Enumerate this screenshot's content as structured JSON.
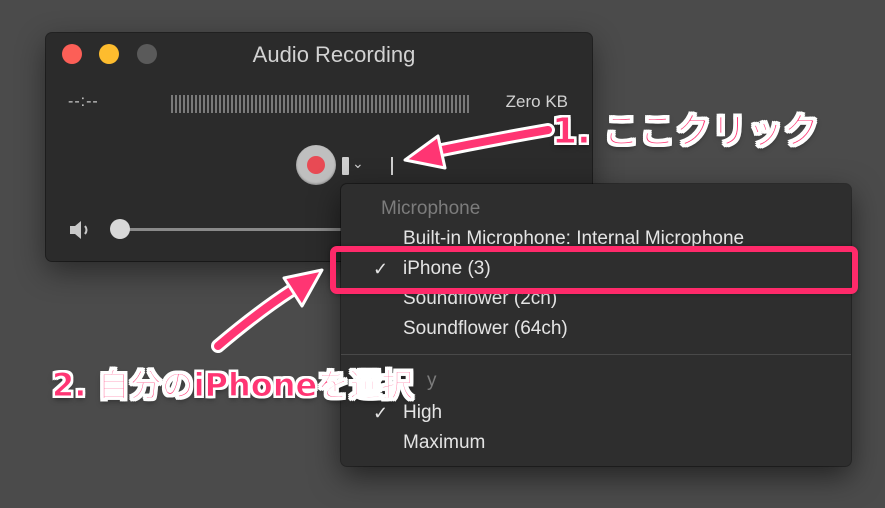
{
  "window": {
    "title": "Audio Recording",
    "elapsed_time": "--:--",
    "file_size": "Zero KB"
  },
  "menu": {
    "microphone_header": "Microphone",
    "microphones": [
      {
        "label": "Built-in Microphone: Internal Microphone",
        "checked": false
      },
      {
        "label": "iPhone (3)",
        "checked": true
      },
      {
        "label": "Soundflower (2ch)",
        "checked": false
      },
      {
        "label": "Soundflower (64ch)",
        "checked": false
      }
    ],
    "quality_header_partial": "y",
    "qualities": [
      {
        "label": "High",
        "checked": true
      },
      {
        "label": "Maximum",
        "checked": false
      }
    ],
    "check_mark": "✓"
  },
  "annotations": {
    "step1": "1. ここクリック",
    "step2": "2. 自分のiPhoneを選択",
    "color": "#ff3573"
  },
  "icons": [
    "record-icon",
    "dropdown-chevron-icon",
    "speaker-icon"
  ]
}
